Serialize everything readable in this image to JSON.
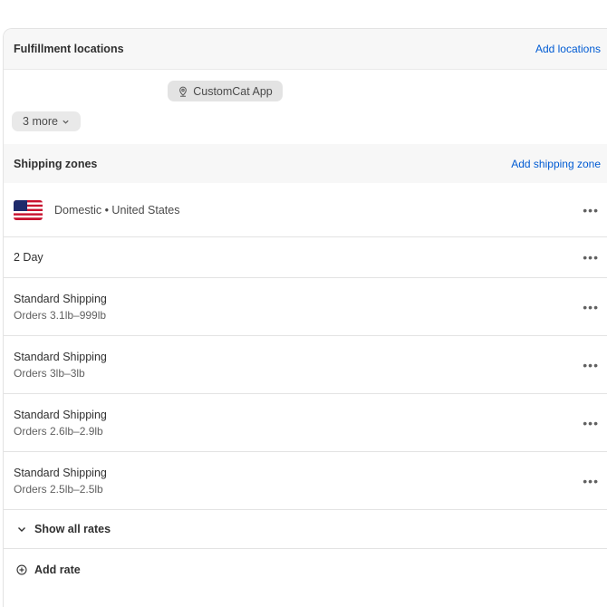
{
  "fulfillment": {
    "title": "Fulfillment locations",
    "add_link": "Add locations",
    "location_name": "CustomCat App",
    "more_label": "3 more"
  },
  "shipping": {
    "title": "Shipping zones",
    "add_link": "Add shipping zone",
    "zone_label": "Domestic • United States",
    "rates": [
      {
        "name": "2 Day",
        "condition": ""
      },
      {
        "name": "Standard Shipping",
        "condition": "Orders 3.1lb–999lb"
      },
      {
        "name": "Standard Shipping",
        "condition": "Orders 3lb–3lb"
      },
      {
        "name": "Standard Shipping",
        "condition": "Orders 2.6lb–2.9lb"
      },
      {
        "name": "Standard Shipping",
        "condition": "Orders 2.5lb–2.5lb"
      }
    ],
    "show_all_label": "Show all rates",
    "add_rate_label": "Add rate"
  },
  "menu_glyph": "•••",
  "icons": {
    "location": "location-pin-icon",
    "more": "chevron-down-icon",
    "flag": "us-flag-icon",
    "add": "plus-circle-icon"
  },
  "colors": {
    "link": "#005bd3",
    "header_bg": "#f7f7f7",
    "pill_bg": "#e3e3e3"
  }
}
